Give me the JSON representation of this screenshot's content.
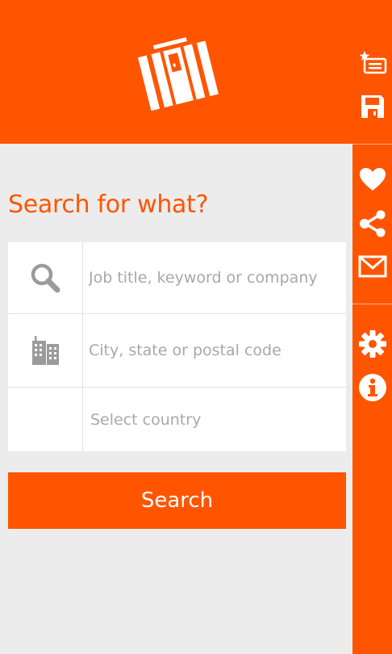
{
  "colors": {
    "accent": "#ff5500",
    "background": "#ececec",
    "field_background": "#ffffff",
    "placeholder": "#a8a8a8"
  },
  "header": {
    "logo_icon": "briefcase-logo-icon"
  },
  "sidebar": {
    "items": [
      {
        "name": "saved-searches",
        "icon": "starred-list-icon"
      },
      {
        "name": "save",
        "icon": "floppy-disk-icon"
      },
      {
        "name": "favorites",
        "icon": "heart-icon"
      },
      {
        "name": "share",
        "icon": "share-icon"
      },
      {
        "name": "email",
        "icon": "envelope-icon"
      },
      {
        "name": "settings",
        "icon": "gear-icon"
      },
      {
        "name": "about",
        "icon": "info-icon"
      }
    ]
  },
  "main": {
    "title": "Search for what?",
    "keyword_field": {
      "placeholder": "Job title, keyword or company",
      "value": "",
      "icon": "search-icon"
    },
    "location_field": {
      "placeholder": "City, state or postal code",
      "value": "",
      "icon": "city-buildings-icon"
    },
    "country_select": {
      "selected": "Select country"
    },
    "search_button": {
      "label": "Search"
    }
  }
}
